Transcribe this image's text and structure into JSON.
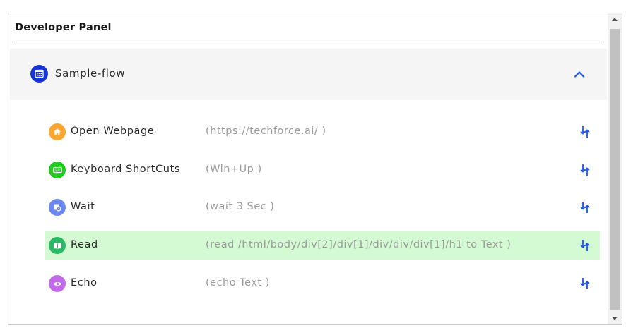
{
  "panel": {
    "title": "Developer Panel"
  },
  "flow": {
    "name": "Sample-flow",
    "icon": "calendar-grid-icon",
    "expanded": true,
    "collapse_icon": "chevron-up-icon"
  },
  "steps": [
    {
      "label": "Open Webpage",
      "detail": "(https://techforce.ai/ )",
      "icon": "home-icon",
      "icon_color": "#f8a531",
      "highlighted": false
    },
    {
      "label": "Keyboard ShortCuts",
      "detail": "(Win+Up )",
      "icon": "keyboard-icon",
      "icon_color": "#1fcc1f",
      "highlighted": false
    },
    {
      "label": "Wait",
      "detail": "(wait 3 Sec )",
      "icon": "clock-icon",
      "icon_color": "#6a88ef",
      "highlighted": false
    },
    {
      "label": "Read",
      "detail": "(read /html/body/div[2]/div[1]/div/div/div[1]/h1 to Text )",
      "icon": "book-icon",
      "icon_color": "#29b864",
      "highlighted": true
    },
    {
      "label": "Echo",
      "detail": "(echo Text )",
      "icon": "eye-icon",
      "icon_color": "#c36ae8",
      "highlighted": false
    }
  ],
  "colors": {
    "accent": "#1a56e8",
    "highlight_row": "#d4fad3",
    "flow_header_bg": "#f5f5f5"
  }
}
